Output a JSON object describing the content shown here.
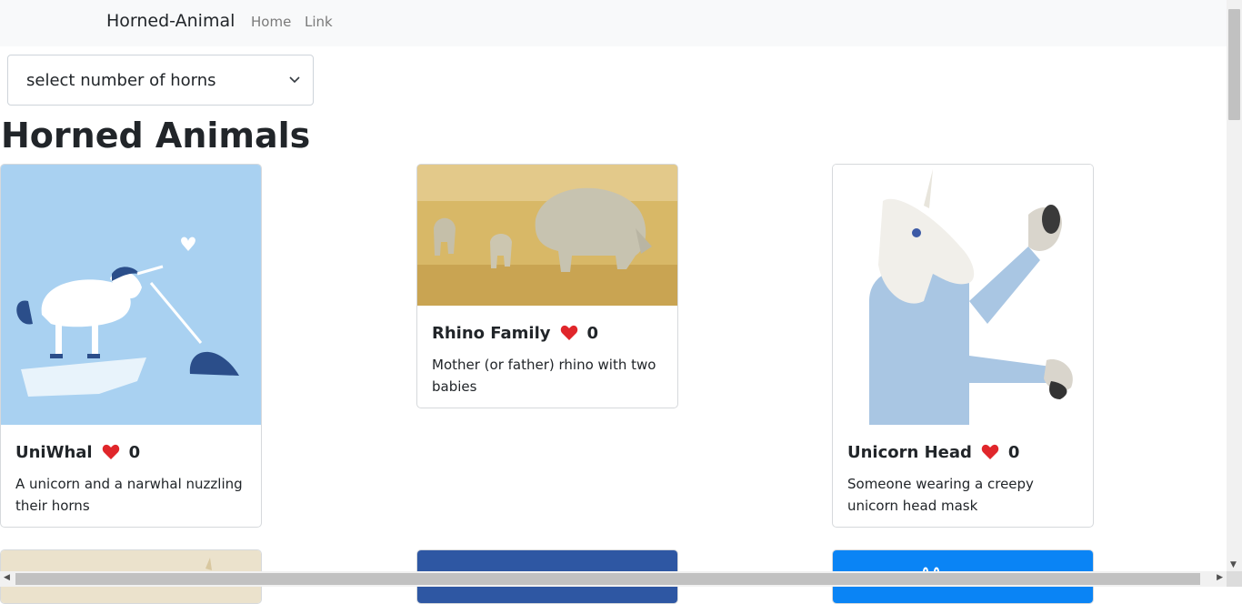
{
  "navbar": {
    "brand": "Horned-Animal",
    "links": [
      "Home",
      "Link"
    ]
  },
  "filter": {
    "selected": "select number of horns"
  },
  "page": {
    "title": "Horned Animals"
  },
  "cards": [
    {
      "title": "UniWhal",
      "likes": "0",
      "description": "A unicorn and a narwhal nuzzling their horns"
    },
    {
      "title": "Rhino Family",
      "likes": "0",
      "description": "Mother (or father) rhino with two babies"
    },
    {
      "title": "Unicorn Head",
      "likes": "0",
      "description": "Someone wearing a creepy unicorn head mask"
    }
  ],
  "colors": {
    "navbar_bg": "#f8f9fa",
    "heart": "#e0262b",
    "card_border": "#d6d9dc"
  },
  "icons": {
    "like": "heart-icon",
    "dropdown": "chevron-down-icon"
  }
}
